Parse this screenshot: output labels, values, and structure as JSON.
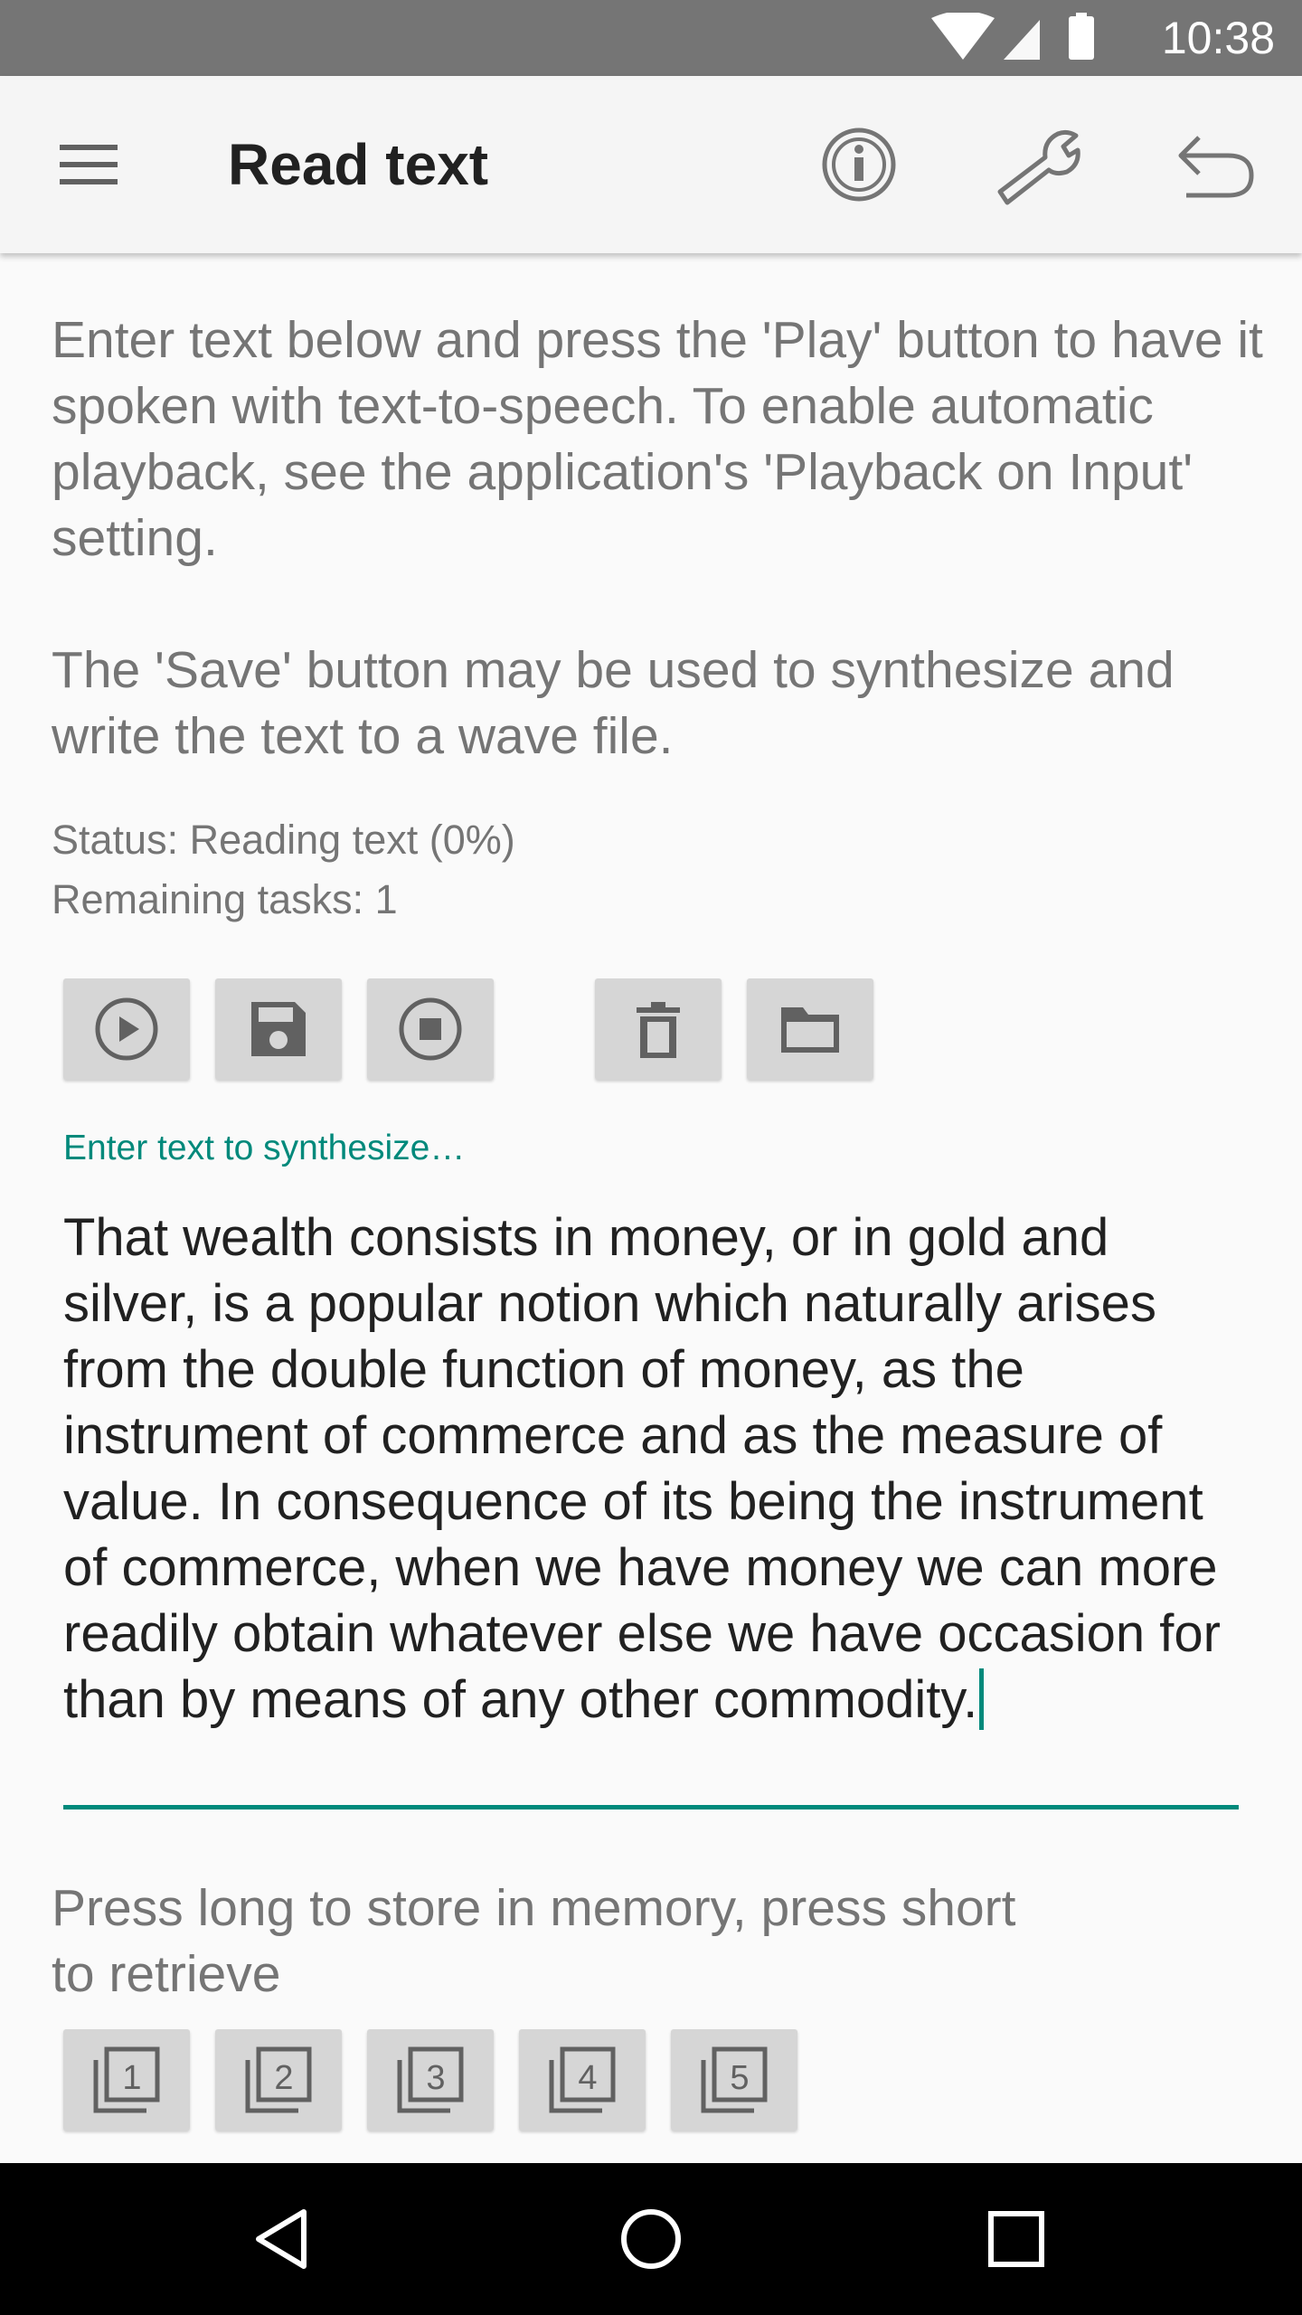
{
  "status_bar": {
    "time": "10:38",
    "icons": [
      "wifi-icon",
      "cellular-signal-icon",
      "battery-icon"
    ]
  },
  "app_bar": {
    "title": "Read text",
    "icons": [
      "menu-icon",
      "info-icon",
      "wrench-icon",
      "undo-icon"
    ]
  },
  "intro": {
    "paragraph_1": "Enter text below and press the 'Play' button to have it spoken with text-to-speech. To enable automatic playback, see the application's 'Playback on Input' setting.",
    "paragraph_2": "The 'Save' button may be used to synthesize and write the text to a wave file."
  },
  "status": {
    "line_1": "Status: Reading text (0%)",
    "line_2": "Remaining tasks: 1"
  },
  "toolbar": {
    "buttons": [
      "play-icon",
      "save-icon",
      "stop-icon",
      "delete-icon",
      "folder-icon"
    ]
  },
  "text_field": {
    "label": "Enter text to synthesize…",
    "value": "That wealth consists in money, or in gold and silver, is a popular notion which naturally arises from the double function of money, as the instrument of commerce and as the measure of value.  In consequence of its being the instrument of commerce, when we have money we can more readily obtain whatever else we have occasion for than by means of any other commodity."
  },
  "memory": {
    "label": "Press long to store in memory, press short to retrieve",
    "slots": [
      {
        "label": "1"
      },
      {
        "label": "2"
      },
      {
        "label": "3"
      },
      {
        "label": "4"
      },
      {
        "label": "5"
      }
    ]
  },
  "colors": {
    "accent": "#00897b",
    "status_bar": "#757575",
    "app_bar": "#f5f5f5",
    "button": "#d6d6d6",
    "nav_bar": "#000000"
  },
  "nav_bar": {
    "icons": [
      "back-icon",
      "home-icon",
      "recents-icon"
    ]
  }
}
